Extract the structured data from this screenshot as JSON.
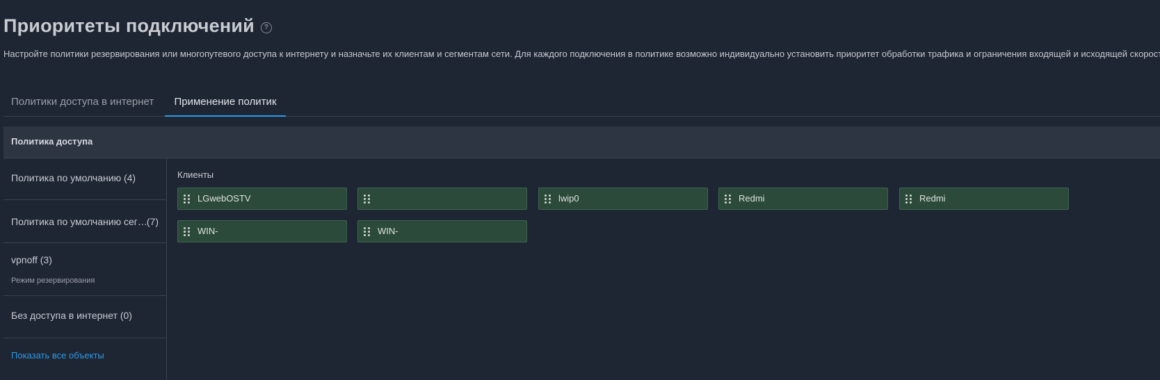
{
  "page": {
    "title": "Приоритеты подключений",
    "help_icon": "question-circle-icon",
    "description": "Настройте политики резервирования или многопутевого доступа к интернету и назначьте их клиентам и сегментам сети. Для каждого подключения в политике возможно индивидуально установить приоритет обработки трафика и ограничения входящей и исходящей скорости."
  },
  "tabs": [
    {
      "label": "Политики доступа в интернет",
      "active": false
    },
    {
      "label": "Применение политик",
      "active": true
    }
  ],
  "panel": {
    "header": "Политика доступа"
  },
  "sidebar": {
    "items": [
      {
        "name": "Политика по умолчанию (4)",
        "count": "",
        "sub": ""
      },
      {
        "name": "Политика по умолчанию сег…",
        "count": "(7)",
        "sub": ""
      },
      {
        "name": "vpnoff (3)",
        "count": "",
        "sub": "Режим резервирования"
      },
      {
        "name": "Без доступа в интернет (0)",
        "count": "",
        "sub": ""
      }
    ],
    "show_all": "Показать все объекты"
  },
  "clients": {
    "label": "Клиенты",
    "drag_icon": "drag-handle-icon",
    "items": [
      {
        "name": "LGwebOSTV"
      },
      {
        "name": ""
      },
      {
        "name": "lwip0"
      },
      {
        "name": "Redmi"
      },
      {
        "name": "Redmi"
      },
      {
        "name": "WIN-"
      },
      {
        "name": "WIN-"
      }
    ]
  },
  "colors": {
    "background": "#1e2533",
    "accent": "#2d9be8",
    "chip_background": "#2b4a3a",
    "chip_border": "#3f6550"
  }
}
